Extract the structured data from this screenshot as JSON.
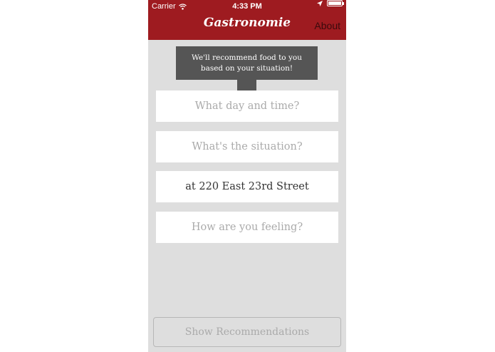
{
  "status_bar": {
    "carrier": "Carrier",
    "time": "4:33 PM",
    "battery_level": 1.0
  },
  "header": {
    "brand": "Gastronomie",
    "about_label": "About",
    "background_color": "#9e1b20"
  },
  "tooltip": {
    "text_line1": "We'll recommend food to you",
    "text_line2": "based on your situation!"
  },
  "fields": {
    "day_time": "What day and time?",
    "situation": "What's the situation?",
    "location": "at 220 East 23rd Street",
    "feeling": "How are you feeling?"
  },
  "footer": {
    "show_button_label": "Show Recommendations"
  },
  "icons": [
    "wifi-icon",
    "location-arrow-icon",
    "battery-icon"
  ]
}
